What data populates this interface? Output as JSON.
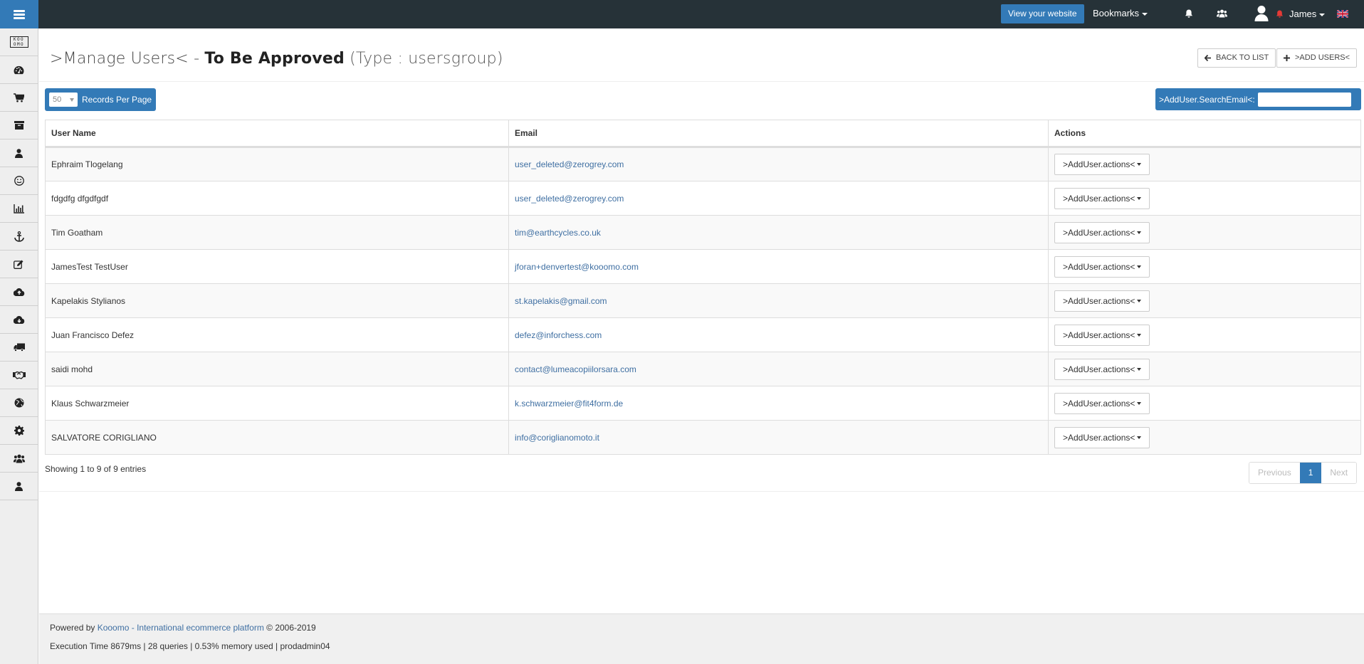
{
  "topbar": {
    "menu_icon": "hamburger-icon",
    "view_website_label": "View your website",
    "bookmarks_label": "Bookmarks",
    "notifications_icon": "bell-icon",
    "groups_icon": "users-icon",
    "avatar_icon": "user-avatar-icon",
    "alert_icon": "bell-icon-red",
    "user_name": "James",
    "language_icon": "uk-flag-icon"
  },
  "sidebar": {
    "items": [
      {
        "name": "kooomo-logo",
        "icon": "logo",
        "logo_text": "KOOOMO"
      },
      {
        "name": "dashboard",
        "icon": "dashboard-icon"
      },
      {
        "name": "orders",
        "icon": "cart-icon"
      },
      {
        "name": "products",
        "icon": "archive-icon"
      },
      {
        "name": "customers",
        "icon": "user-icon"
      },
      {
        "name": "marketing",
        "icon": "smile-icon"
      },
      {
        "name": "reports",
        "icon": "bar-chart-icon"
      },
      {
        "name": "seo",
        "icon": "anchor-icon"
      },
      {
        "name": "content",
        "icon": "edit-icon"
      },
      {
        "name": "import",
        "icon": "cloud-upload-icon"
      },
      {
        "name": "export",
        "icon": "cloud-download-icon"
      },
      {
        "name": "shipping",
        "icon": "truck-icon"
      },
      {
        "name": "partners",
        "icon": "handshake-icon"
      },
      {
        "name": "websites",
        "icon": "globe-icon"
      },
      {
        "name": "settings",
        "icon": "gear-icon"
      },
      {
        "name": "user-groups",
        "icon": "users-icon"
      },
      {
        "name": "account",
        "icon": "user-icon"
      }
    ]
  },
  "page": {
    "title_prefix": ">Manage Users< - ",
    "title_bold": "To Be Approved",
    "title_suffix": " (Type : usersgroup)",
    "back_label": "BACK TO LIST",
    "add_label": ">ADD USERS<"
  },
  "controls": {
    "records_per_page_value": "50",
    "records_per_page_label": "Records Per Page",
    "search_label": ">AddUser.SearchEmail<:",
    "search_value": "",
    "search_placeholder": ""
  },
  "table": {
    "headers": [
      "User Name",
      "Email",
      "Actions"
    ],
    "rows": [
      {
        "name": "Ephraim Tlogelang",
        "email": "user_deleted@zerogrey.com",
        "action": ">AddUser.actions<"
      },
      {
        "name": "fdgdfg dfgdfgdf",
        "email": "user_deleted@zerogrey.com",
        "action": ">AddUser.actions<"
      },
      {
        "name": "Tim Goatham",
        "email": "tim@earthcycles.co.uk",
        "action": ">AddUser.actions<"
      },
      {
        "name": "JamesTest TestUser",
        "email": "jforan+denvertest@kooomo.com",
        "action": ">AddUser.actions<"
      },
      {
        "name": "Kapelakis Stylianos",
        "email": "st.kapelakis@gmail.com",
        "action": ">AddUser.actions<"
      },
      {
        "name": "Juan Francisco Defez",
        "email": "defez@inforchess.com",
        "action": ">AddUser.actions<"
      },
      {
        "name": "saidi mohd",
        "email": "contact@lumeacopiilorsara.com",
        "action": ">AddUser.actions<"
      },
      {
        "name": "Klaus Schwarzmeier",
        "email": "k.schwarzmeier@fit4form.de",
        "action": ">AddUser.actions<"
      },
      {
        "name": "SALVATORE CORIGLIANO",
        "email": "info@coriglianomoto.it",
        "action": ">AddUser.actions<"
      }
    ]
  },
  "pagination": {
    "showing_text": "Showing 1 to 9 of 9 entries",
    "previous_label": "Previous",
    "current_page": "1",
    "next_label": "Next"
  },
  "footer": {
    "powered_prefix": "Powered by ",
    "powered_link": "Kooomo - International ecommerce platform",
    "powered_suffix": " © 2006-2019",
    "stats": "Execution Time 8679ms | 28 queries | 0.53% memory used | prodadmin04"
  },
  "colors": {
    "topbar_bg": "#263238",
    "accent": "#337ab7",
    "link": "#3f6fa2",
    "sidebar_bg": "#eeeeee",
    "alert_red": "#e53935"
  }
}
